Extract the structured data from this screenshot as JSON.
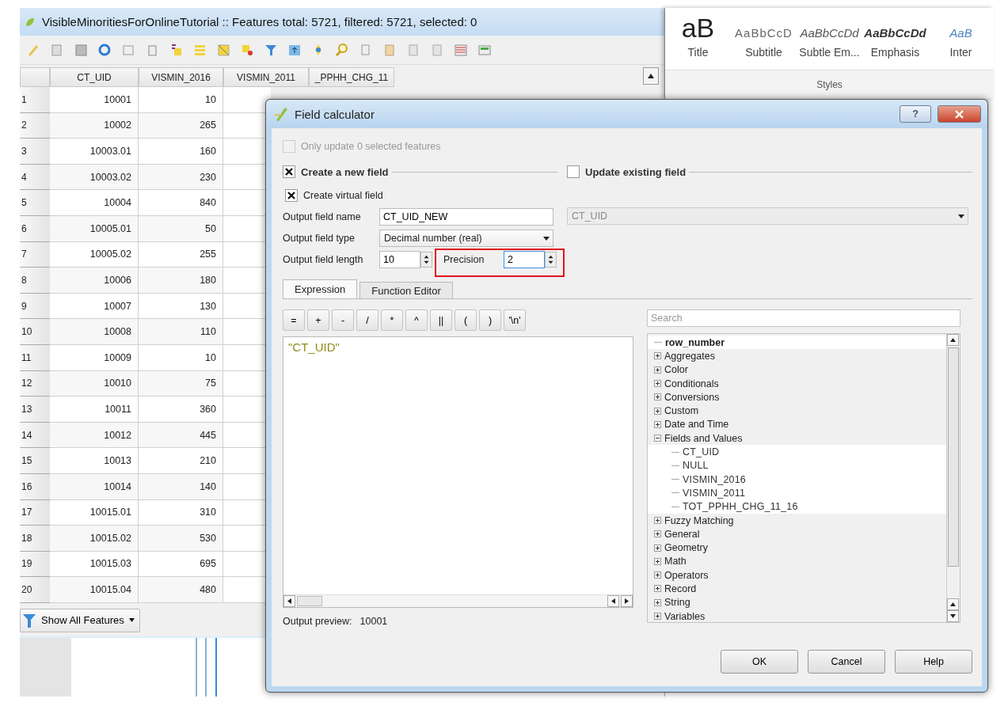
{
  "attribute_table": {
    "title": "VisibleMinoritiesForOnlineTutorial :: Features total: 5721, filtered: 5721, selected: 0",
    "columns": [
      "CT_UID",
      "VISMIN_2016",
      "VISMIN_2011",
      "_PPHH_CHG_11"
    ],
    "rows": [
      {
        "number": "1",
        "cells": [
          "10001",
          "10"
        ]
      },
      {
        "number": "2",
        "cells": [
          "10002",
          "265"
        ]
      },
      {
        "number": "3",
        "cells": [
          "10003.01",
          "160"
        ]
      },
      {
        "number": "4",
        "cells": [
          "10003.02",
          "230"
        ]
      },
      {
        "number": "5",
        "cells": [
          "10004",
          "840"
        ]
      },
      {
        "number": "6",
        "cells": [
          "10005.01",
          "50"
        ]
      },
      {
        "number": "7",
        "cells": [
          "10005.02",
          "255"
        ]
      },
      {
        "number": "8",
        "cells": [
          "10006",
          "180"
        ]
      },
      {
        "number": "9",
        "cells": [
          "10007",
          "130"
        ]
      },
      {
        "number": "10",
        "cells": [
          "10008",
          "110"
        ]
      },
      {
        "number": "11",
        "cells": [
          "10009",
          "10"
        ]
      },
      {
        "number": "12",
        "cells": [
          "10010",
          "75"
        ]
      },
      {
        "number": "13",
        "cells": [
          "10011",
          "360"
        ]
      },
      {
        "number": "14",
        "cells": [
          "10012",
          "445"
        ]
      },
      {
        "number": "15",
        "cells": [
          "10013",
          "210"
        ]
      },
      {
        "number": "16",
        "cells": [
          "10014",
          "140"
        ]
      },
      {
        "number": "17",
        "cells": [
          "10015.01",
          "310"
        ]
      },
      {
        "number": "18",
        "cells": [
          "10015.02",
          "530"
        ]
      },
      {
        "number": "19",
        "cells": [
          "10015.03",
          "695"
        ]
      },
      {
        "number": "20",
        "cells": [
          "10015.04",
          "480"
        ]
      }
    ],
    "filter_button": "Show All Features"
  },
  "ribbon": {
    "styles": [
      {
        "sample": "aB",
        "label": "Title",
        "kind": "title"
      },
      {
        "sample": "AaBbCcD",
        "label": "Subtitle",
        "kind": "subtitle"
      },
      {
        "sample": "AaBbCcDd",
        "label": "Subtle Em...",
        "kind": "subtle"
      },
      {
        "sample": "AaBbCcDd",
        "label": "Emphasis",
        "kind": "emphasis"
      },
      {
        "sample": "AaB",
        "label": "Inter",
        "kind": "intense"
      }
    ],
    "group_label": "Styles"
  },
  "dialog": {
    "title": "Field calculator",
    "help_glyph": "?",
    "only_selected": {
      "label": "Only update 0 selected features",
      "checked": false,
      "disabled": true
    },
    "create_new": {
      "label": "Create a new field",
      "checked": true
    },
    "update_existing": {
      "label": "Update existing field",
      "checked": false
    },
    "virtual": {
      "label": "Create virtual field",
      "checked": true
    },
    "output_name": {
      "label": "Output field name",
      "value": "CT_UID_NEW"
    },
    "output_type": {
      "label": "Output field type",
      "value": "Decimal number (real)"
    },
    "output_length": {
      "label": "Output field length",
      "value": "10"
    },
    "precision": {
      "label": "Precision",
      "value": "2"
    },
    "existing_field": {
      "value": "CT_UID",
      "disabled": true
    },
    "tabs": [
      {
        "label": "Expression",
        "selected": true
      },
      {
        "label": "Function Editor",
        "selected": false
      }
    ],
    "operators": [
      "=",
      "+",
      "-",
      "/",
      "*",
      "^",
      "||",
      "(",
      ")",
      "'\\n'"
    ],
    "expression": "\"CT_UID\"",
    "preview": {
      "label": "Output preview:",
      "value": "10001"
    },
    "search": {
      "placeholder": "Search"
    },
    "tree": [
      {
        "label": "row_number",
        "kind": "function"
      },
      {
        "label": "Aggregates",
        "kind": "group",
        "expanded": false
      },
      {
        "label": "Color",
        "kind": "group",
        "expanded": false
      },
      {
        "label": "Conditionals",
        "kind": "group",
        "expanded": false
      },
      {
        "label": "Conversions",
        "kind": "group",
        "expanded": false
      },
      {
        "label": "Custom",
        "kind": "group",
        "expanded": false
      },
      {
        "label": "Date and Time",
        "kind": "group",
        "expanded": false
      },
      {
        "label": "Fields and Values",
        "kind": "group",
        "expanded": true,
        "children": [
          {
            "label": "CT_UID",
            "kind": "field"
          },
          {
            "label": "NULL",
            "kind": "field"
          },
          {
            "label": "VISMIN_2016",
            "kind": "field"
          },
          {
            "label": "VISMIN_2011",
            "kind": "field"
          },
          {
            "label": "TOT_PPHH_CHG_11_16",
            "kind": "field"
          }
        ]
      },
      {
        "label": "Fuzzy Matching",
        "kind": "group",
        "expanded": false
      },
      {
        "label": "General",
        "kind": "group",
        "expanded": false
      },
      {
        "label": "Geometry",
        "kind": "group",
        "expanded": false
      },
      {
        "label": "Math",
        "kind": "group",
        "expanded": false
      },
      {
        "label": "Operators",
        "kind": "group",
        "expanded": false
      },
      {
        "label": "Record",
        "kind": "group",
        "expanded": false
      },
      {
        "label": "String",
        "kind": "group",
        "expanded": false
      },
      {
        "label": "Variables",
        "kind": "group",
        "expanded": false
      }
    ],
    "buttons": [
      "OK",
      "Cancel",
      "Help"
    ]
  }
}
